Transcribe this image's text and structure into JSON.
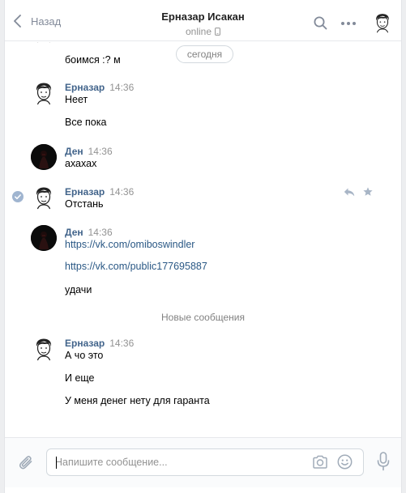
{
  "header": {
    "back_label": "Назад",
    "title": "Ерназар Исакан",
    "status": "online"
  },
  "messages": {
    "date_pill": "сегодня",
    "partial_text": "боимся :? м",
    "groups": [
      {
        "author": "Ерназар",
        "time": "14:36",
        "lines": [
          "Неет",
          "Все пока"
        ]
      },
      {
        "author": "Ден",
        "time": "14:36",
        "lines": [
          "ахахах"
        ]
      },
      {
        "author": "Ерназар",
        "time": "14:36",
        "lines": [
          "Отстань"
        ]
      },
      {
        "author": "Ден",
        "time": "14:36",
        "links": [
          "https://vk.com/omiboswindler",
          "https://vk.com/public177695887"
        ],
        "lines": [
          "удачи"
        ]
      },
      {
        "author": "Ерназар",
        "time": "14:36",
        "lines": [
          "А чо это",
          "И еще",
          "У меня денег нету для гаранта"
        ]
      }
    ],
    "new_messages_label": "Новые сообщения"
  },
  "composer": {
    "placeholder": "Напишите сообщение...",
    "value": ""
  },
  "colors": {
    "author": "#42648b",
    "link": "#2a5885",
    "muted": "#939393",
    "accent_check": "#a0b5d0"
  },
  "icons": [
    "chevron-left-icon",
    "phone-icon",
    "search-icon",
    "more-icon",
    "checkmark-icon",
    "reply-icon",
    "star-icon",
    "paperclip-icon",
    "camera-icon",
    "emoji-icon",
    "microphone-icon"
  ]
}
